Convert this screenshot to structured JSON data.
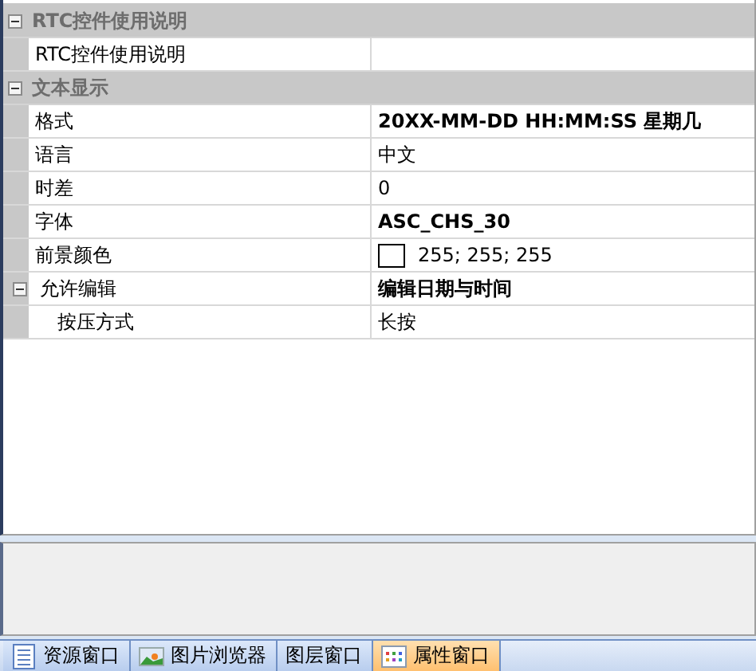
{
  "property_grid": {
    "categories": [
      {
        "title": "RTC控件使用说明",
        "expanded": true,
        "rows": [
          {
            "name": "RTC控件使用说明"
          }
        ]
      },
      {
        "title": "文本显示",
        "expanded": true,
        "rows": [
          {
            "name": "格式",
            "value": "20XX-MM-DD HH:MM:SS 星期几",
            "bold": true
          },
          {
            "name": "语言",
            "value": "中文",
            "bold": false
          },
          {
            "name": "时差",
            "value": "0",
            "bold": false
          },
          {
            "name": "字体",
            "value": "ASC_CHS_30",
            "bold": true
          },
          {
            "name": "前景颜色",
            "value": "255; 255; 255",
            "bold": false,
            "kind": "color",
            "color": "#ffffff"
          },
          {
            "name": "允许编辑",
            "value": "编辑日期与时间",
            "bold": true,
            "expanded": true,
            "children": [
              {
                "name": "按压方式",
                "value": "长按",
                "bold": false
              }
            ]
          }
        ]
      }
    ]
  },
  "tabs": [
    {
      "label": "资源窗口",
      "selected": false
    },
    {
      "label": "图片浏览器",
      "selected": false
    },
    {
      "label": "图层窗口",
      "selected": false
    },
    {
      "label": "属性窗口",
      "selected": true
    }
  ]
}
